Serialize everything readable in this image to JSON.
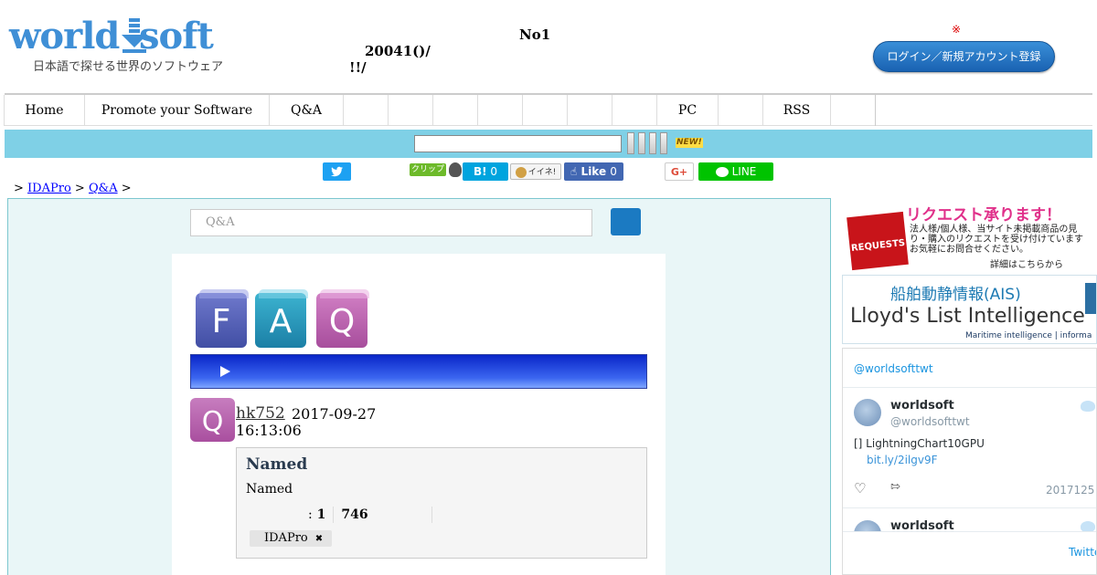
{
  "header": {
    "logo_world": "world",
    "logo_soft": "soft",
    "logo_tagline": "日本語で探せる世界のソフトウェア",
    "headline": "No1",
    "line1": "20041()/",
    "line2": "!!/",
    "mark": "※",
    "login_label": "ログイン／新規アカウント登録"
  },
  "nav": {
    "items": [
      "Home",
      "Promote your Software",
      "Q&A",
      "",
      "",
      "",
      "",
      "",
      "",
      "",
      "PC",
      "",
      "RSS",
      ""
    ]
  },
  "search": {
    "new_badge": "NEW!"
  },
  "social": {
    "clip_label": "クリップ",
    "hatena_label": "B!",
    "hatena_count": "0",
    "mixi_label": "イイネ!",
    "fb_like_label": "Like",
    "fb_count": "0",
    "gplus_label": "G+",
    "line_label": "LINE"
  },
  "breadcrumb": {
    "sep1": ">",
    "link1": "IDAPro",
    "sep2": ">",
    "link2": "Q&A",
    "sep3": ">"
  },
  "main": {
    "search_placeholder": "Q&A",
    "faq_letters": [
      "F",
      "A",
      "Q"
    ],
    "question": {
      "icon": "Q",
      "user": "hk752",
      "date": "2017-09-27",
      "time": "16:13:06",
      "title": "Named",
      "body": "Named",
      "stat_sep": ":",
      "stat_answers": "1",
      "stat_views": "746",
      "tag": "IDAPro",
      "tag_remove": "✖"
    }
  },
  "sidebar": {
    "ad1": {
      "box_label": "REQUESTS",
      "title": "リクエスト承ります！",
      "line1": "法人様/個人様、当サイト未掲載商品の見",
      "line2": "り・購入のリクエストを受け付けています",
      "line3": "お気軽にお問合せください。",
      "link": "詳細はこちらから"
    },
    "ad2": {
      "ja": "船舶動静情報(AIS)",
      "en": "Lloyd's List Intelligence",
      "sub": "Maritime intelligence | informa"
    },
    "twitter": {
      "handle": "@worldsofttwt",
      "name": "worldsoft",
      "at": "@worldsofttwt",
      "text": "[] LightningChart10GPU",
      "link": "bit.ly/2ilgv9F",
      "date": "2017125",
      "name2": "worldsoft",
      "view_label": "Twitte"
    }
  },
  "colors": {
    "accent": "#7fd0e6",
    "link": "#0000ff",
    "main_bg": "#e9f6f7",
    "brand_blue": "#3f8fd6"
  }
}
